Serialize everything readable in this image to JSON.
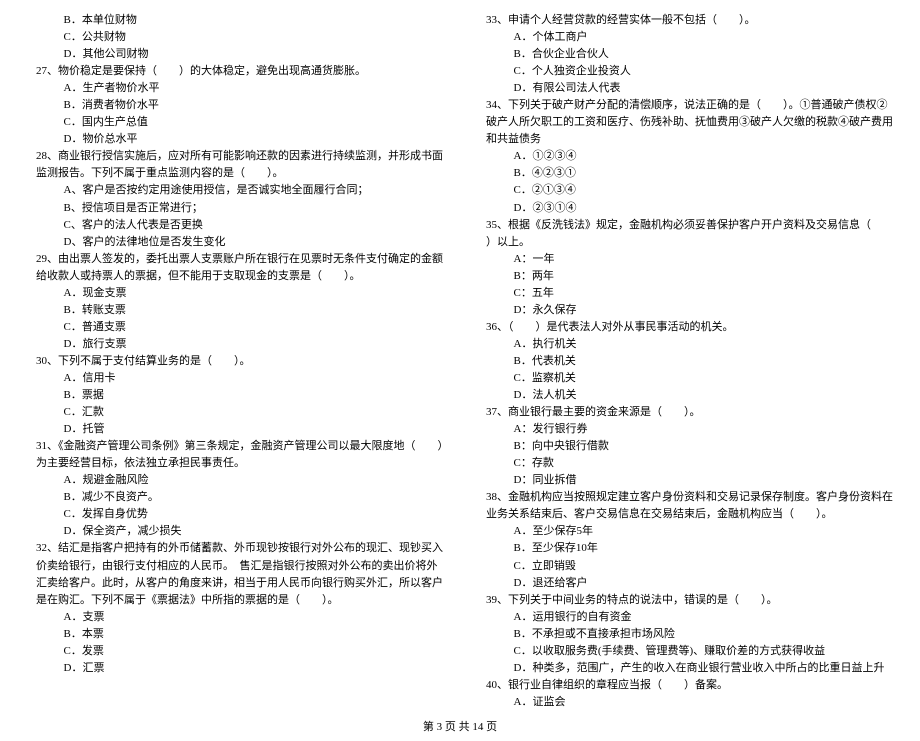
{
  "left": [
    {
      "cls": "indent2",
      "t": "B．本单位财物"
    },
    {
      "cls": "indent2",
      "t": "C．公共财物"
    },
    {
      "cls": "indent2",
      "t": "D．其他公司财物"
    },
    {
      "cls": "indent0",
      "t": "27、物价稳定是要保持（　　）的大体稳定，避免出现高通货膨胀。"
    },
    {
      "cls": "indent2",
      "t": "A．生产者物价水平"
    },
    {
      "cls": "indent2",
      "t": "B．消费者物价水平"
    },
    {
      "cls": "indent2",
      "t": "C．国内生产总值"
    },
    {
      "cls": "indent2",
      "t": "D．物价总水平"
    },
    {
      "cls": "indent0",
      "t": "28、商业银行授信实施后，应对所有可能影响还款的因素进行持续监测，并形成书面监测报告。下列不属于重点监测内容的是（　　）。"
    },
    {
      "cls": "indent2",
      "t": "A、客户是否按约定用途使用授信，是否诚实地全面履行合同；"
    },
    {
      "cls": "indent2",
      "t": "B、授信项目是否正常进行；"
    },
    {
      "cls": "indent2",
      "t": "C、客户的法人代表是否更换"
    },
    {
      "cls": "indent2",
      "t": "D、客户的法律地位是否发生变化"
    },
    {
      "cls": "indent0",
      "t": "29、由出票人签发的，委托出票人支票账户所在银行在见票时无条件支付确定的金额给收款人或持票人的票据，但不能用于支取现金的支票是（　　）。"
    },
    {
      "cls": "indent2",
      "t": "A．现金支票"
    },
    {
      "cls": "indent2",
      "t": "B．转账支票"
    },
    {
      "cls": "indent2",
      "t": "C．普通支票"
    },
    {
      "cls": "indent2",
      "t": "D．旅行支票"
    },
    {
      "cls": "indent0",
      "t": "30、下列不属于支付结算业务的是（　　）。"
    },
    {
      "cls": "indent2",
      "t": "A．信用卡"
    },
    {
      "cls": "indent2",
      "t": "B．票据"
    },
    {
      "cls": "indent2",
      "t": "C．汇款"
    },
    {
      "cls": "indent2",
      "t": "D．托管"
    },
    {
      "cls": "indent0",
      "t": "31、《金融资产管理公司条例》第三条规定，金融资产管理公司以最大限度地（　　）为主要经营目标，依法独立承担民事责任。"
    },
    {
      "cls": "indent2",
      "t": "A．规避金融风险"
    },
    {
      "cls": "indent2",
      "t": "B．减少不良资产。"
    },
    {
      "cls": "indent2",
      "t": "C．发挥自身优势"
    },
    {
      "cls": "indent2",
      "t": "D．保全资产，减少损失"
    },
    {
      "cls": "indent0",
      "t": "32、结汇是指客户把持有的外币储蓄款、外币现钞按银行对外公布的现汇、现钞买入价卖给银行，由银行支付相应的人民币。　售汇是指银行按照对外公布的卖出价将外汇卖给客户。此时，从客户的角度来讲，相当于用人民币向银行购买外汇，所以客户是在购汇。下列不属于《票据法》中所指的票据的是（　　）。"
    },
    {
      "cls": "indent2",
      "t": "A．支票"
    },
    {
      "cls": "indent2",
      "t": "B．本票"
    },
    {
      "cls": "indent2",
      "t": "C．发票"
    },
    {
      "cls": "indent2",
      "t": "D．汇票"
    }
  ],
  "right": [
    {
      "cls": "indent0",
      "t": "33、申请个人经营贷款的经营实体一般不包括（　　）。"
    },
    {
      "cls": "indent2",
      "t": "A．个体工商户"
    },
    {
      "cls": "indent2",
      "t": "B．合伙企业合伙人"
    },
    {
      "cls": "indent2",
      "t": "C．个人独资企业投资人"
    },
    {
      "cls": "indent2",
      "t": "D．有限公司法人代表"
    },
    {
      "cls": "indent0",
      "t": "34、下列关于破产财产分配的清偿顺序，说法正确的是（　　）。①普通破产债权②破产人所欠职工的工资和医疗、伤残补助、抚恤费用③破产人欠缴的税款④破产费用和共益债务"
    },
    {
      "cls": "indent2",
      "t": "A．①②③④"
    },
    {
      "cls": "indent2",
      "t": "B．④②③①"
    },
    {
      "cls": "indent2",
      "t": "C．②①③④"
    },
    {
      "cls": "indent2",
      "t": "D．②③①④"
    },
    {
      "cls": "indent0",
      "t": "35、根据《反洗钱法》规定，金融机构必须妥善保护客户开户资料及交易信息（　　）以上。"
    },
    {
      "cls": "indent2",
      "t": "A：一年"
    },
    {
      "cls": "indent2",
      "t": "B：两年"
    },
    {
      "cls": "indent2",
      "t": "C：五年"
    },
    {
      "cls": "indent2",
      "t": "D：永久保存"
    },
    {
      "cls": "indent0",
      "t": "36、（　　）是代表法人对外从事民事活动的机关。"
    },
    {
      "cls": "indent2",
      "t": "A．执行机关"
    },
    {
      "cls": "indent2",
      "t": "B．代表机关"
    },
    {
      "cls": "indent2",
      "t": "C．监察机关"
    },
    {
      "cls": "indent2",
      "t": "D．法人机关"
    },
    {
      "cls": "indent0",
      "t": "37、商业银行最主要的资金来源是（　　）。"
    },
    {
      "cls": "indent2",
      "t": "A：发行银行券"
    },
    {
      "cls": "indent2",
      "t": "B：向中央银行借款"
    },
    {
      "cls": "indent2",
      "t": "C：存款"
    },
    {
      "cls": "indent2",
      "t": "D：同业拆借"
    },
    {
      "cls": "indent0",
      "t": "38、金融机构应当按照规定建立客户身份资料和交易记录保存制度。客户身份资料在业务关系结束后、客户交易信息在交易结束后，金融机构应当（　　）。"
    },
    {
      "cls": "indent2",
      "t": "A．至少保存5年"
    },
    {
      "cls": "indent2",
      "t": "B．至少保存10年"
    },
    {
      "cls": "indent2",
      "t": "C．立即销毁"
    },
    {
      "cls": "indent2",
      "t": "D．退还给客户"
    },
    {
      "cls": "indent0",
      "t": "39、下列关于中间业务的特点的说法中，错误的是（　　）。"
    },
    {
      "cls": "indent2",
      "t": "A．运用银行的自有资金"
    },
    {
      "cls": "indent2",
      "t": "B．不承担或不直接承担市场风险"
    },
    {
      "cls": "indent2",
      "t": "C．以收取服务费(手续费、管理费等)、赚取价差的方式获得收益"
    },
    {
      "cls": "indent2",
      "t": "D．种类多，范围广，产生的收入在商业银行营业收入中所占的比重日益上升"
    },
    {
      "cls": "indent0",
      "t": "40、银行业自律组织的章程应当报（　　）备案。"
    },
    {
      "cls": "indent2",
      "t": "A．证监会"
    }
  ],
  "footer": "第 3 页 共 14 页"
}
